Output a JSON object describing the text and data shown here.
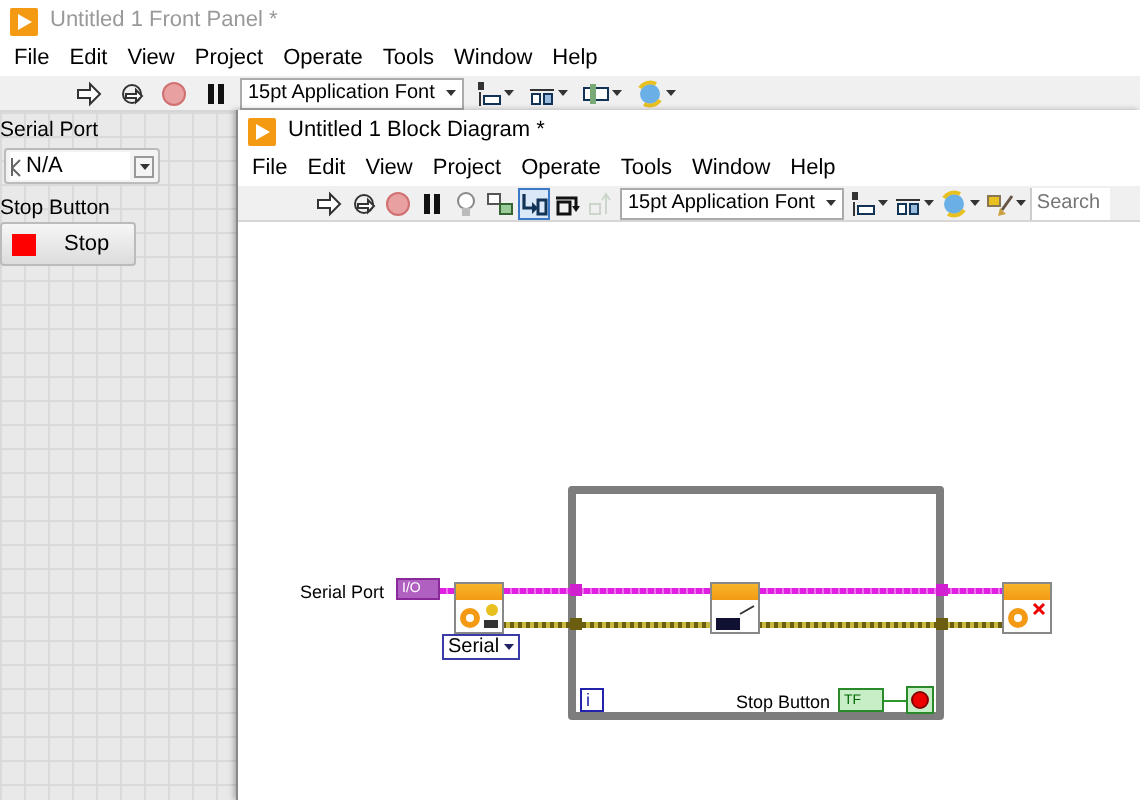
{
  "front_panel": {
    "title": "Untitled 1 Front Panel *",
    "menu": [
      "File",
      "Edit",
      "View",
      "Project",
      "Operate",
      "Tools",
      "Window",
      "Help"
    ],
    "toolbar": {
      "font": "15pt Application Font"
    },
    "controls": [
      {
        "kind": "visa",
        "label": "Serial Port",
        "value": "N/A"
      },
      {
        "kind": "stop",
        "label": "Stop Button",
        "text": "Stop"
      }
    ]
  },
  "block_diagram": {
    "title": "Untitled 1 Block Diagram *",
    "menu": [
      "File",
      "Edit",
      "View",
      "Project",
      "Operate",
      "Tools",
      "Window",
      "Help"
    ],
    "toolbar": {
      "debug_toggles": [
        {
          "on": false,
          "disabled": false
        },
        {
          "on": false,
          "disabled": false
        },
        {
          "on": true,
          "disabled": false
        },
        {
          "on": false,
          "disabled": false
        },
        {
          "on": false,
          "disabled": true
        }
      ],
      "font": "15pt Application Font",
      "search_placeholder": "Search"
    },
    "diagram": {
      "input": {
        "label": "Serial Port",
        "terminal": "I/O"
      },
      "enum": "Serial",
      "iteration": "i",
      "stop": {
        "label": "Stop Button",
        "terminal": "TF"
      }
    }
  }
}
